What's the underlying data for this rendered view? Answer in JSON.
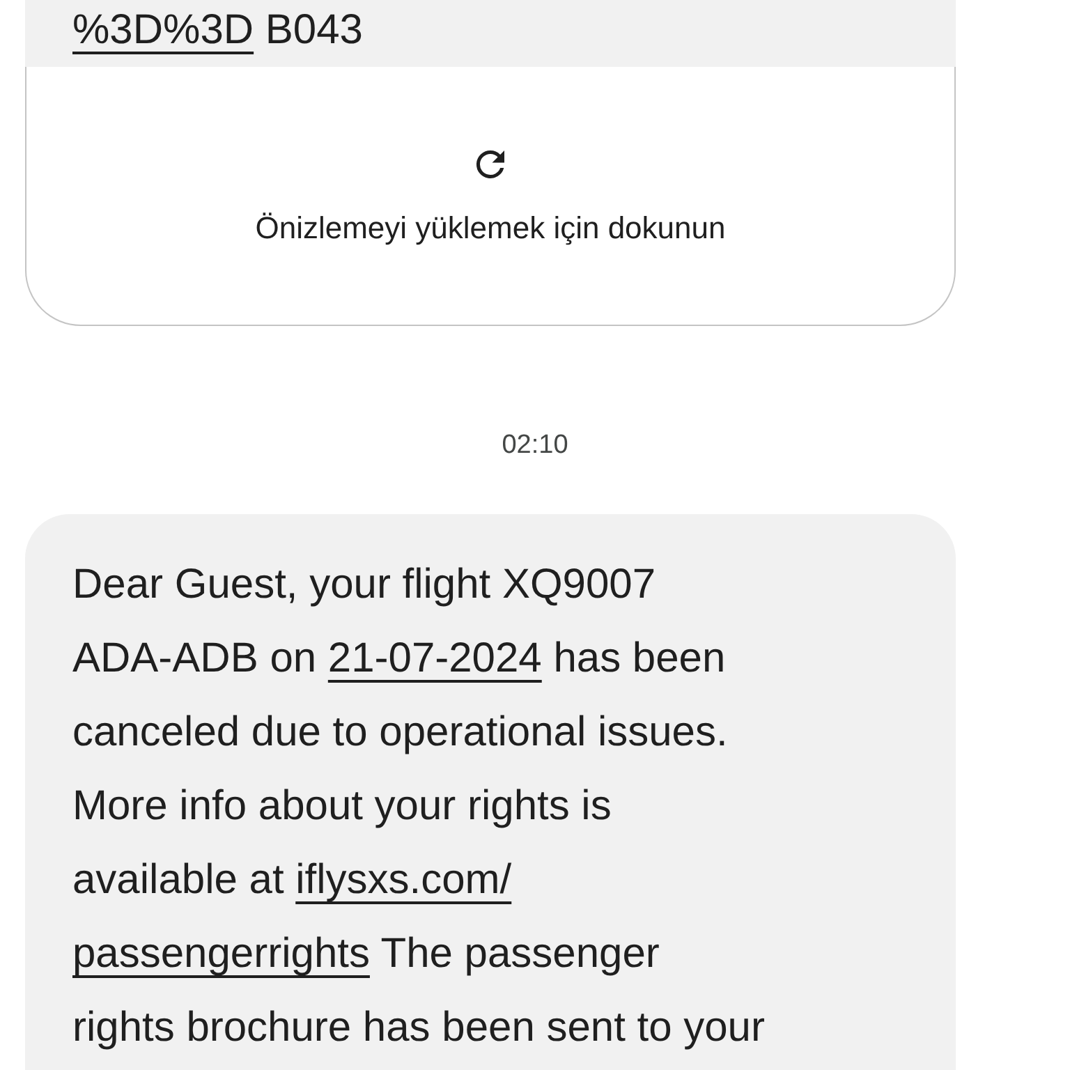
{
  "link_preview": {
    "cut_url_line": [
      {
        "kind": "link",
        "text": "%3D%3D"
      },
      {
        "kind": "text",
        "text": " B043"
      }
    ],
    "caption": "Önizlemeyi yüklemek için dokunun"
  },
  "timestamp": "02:10",
  "message": {
    "lines": [
      [
        {
          "kind": "text",
          "text": "Dear Guest, your flight XQ9007"
        }
      ],
      [
        {
          "kind": "text",
          "text": "ADA-ADB on "
        },
        {
          "kind": "link",
          "text": "21-07-2024"
        },
        {
          "kind": "text",
          "text": " has been"
        }
      ],
      [
        {
          "kind": "text",
          "text": "canceled due to operational issues."
        }
      ],
      [
        {
          "kind": "text",
          "text": "More info about your rights is"
        }
      ],
      [
        {
          "kind": "text",
          "text": "available at "
        },
        {
          "kind": "link",
          "text": "iflysxs.com/"
        }
      ],
      [
        {
          "kind": "link",
          "text": "passengerrights"
        },
        {
          "kind": "text",
          "text": " The passenger"
        }
      ],
      [
        {
          "kind": "text",
          "text": "rights brochure has been sent to your"
        }
      ]
    ]
  }
}
